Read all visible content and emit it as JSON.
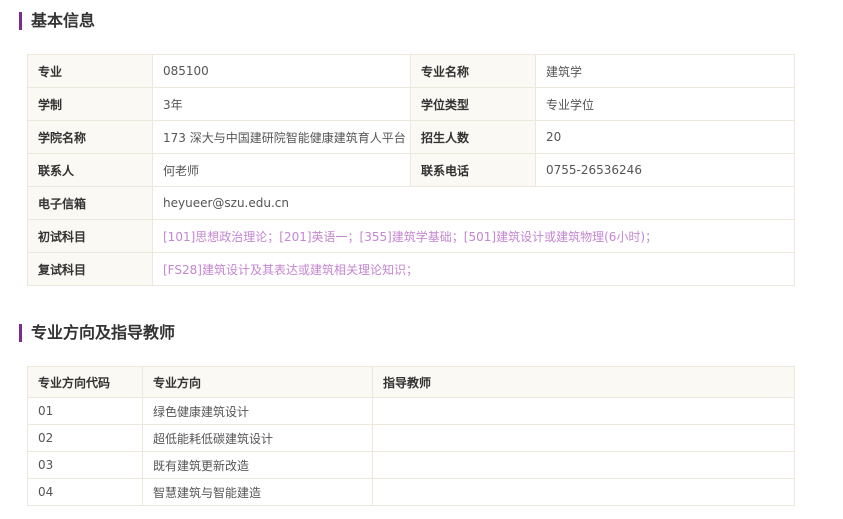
{
  "sections": {
    "basic_info_title": "基本信息",
    "directions_title": "专业方向及指导教师"
  },
  "basic_info": {
    "major_label": "专业",
    "major_value": "085100",
    "major_name_label": "专业名称",
    "major_name_value": "建筑学",
    "duration_label": "学制",
    "duration_value": "3年",
    "degree_type_label": "学位类型",
    "degree_type_value": "专业学位",
    "college_label": "学院名称",
    "college_value": "173 深大与中国建研院智能健康建筑育人平台",
    "enrollment_label": "招生人数",
    "enrollment_value": "20",
    "contact_label": "联系人",
    "contact_value": "何老师",
    "phone_label": "联系电话",
    "phone_value": "0755-26536246",
    "email_label": "电子信箱",
    "email_value": "heyueer@szu.edu.cn",
    "initial_exam_label": "初试科目",
    "initial_exam_value": "[101]思想政治理论；[201]英语一；[355]建筑学基础；[501]建筑设计或建筑物理(6小时)；",
    "retest_label": "复试科目",
    "retest_value": "[FS28]建筑设计及其表达或建筑相关理论知识；"
  },
  "directions": {
    "headers": [
      "专业方向代码",
      "专业方向",
      "指导教师"
    ],
    "rows": [
      {
        "code": "01",
        "name": "绿色健康建筑设计",
        "advisor": ""
      },
      {
        "code": "02",
        "name": "超低能耗低碳建筑设计",
        "advisor": ""
      },
      {
        "code": "03",
        "name": "既有建筑更新改造",
        "advisor": ""
      },
      {
        "code": "04",
        "name": "智慧建筑与智能建造",
        "advisor": ""
      }
    ]
  }
}
